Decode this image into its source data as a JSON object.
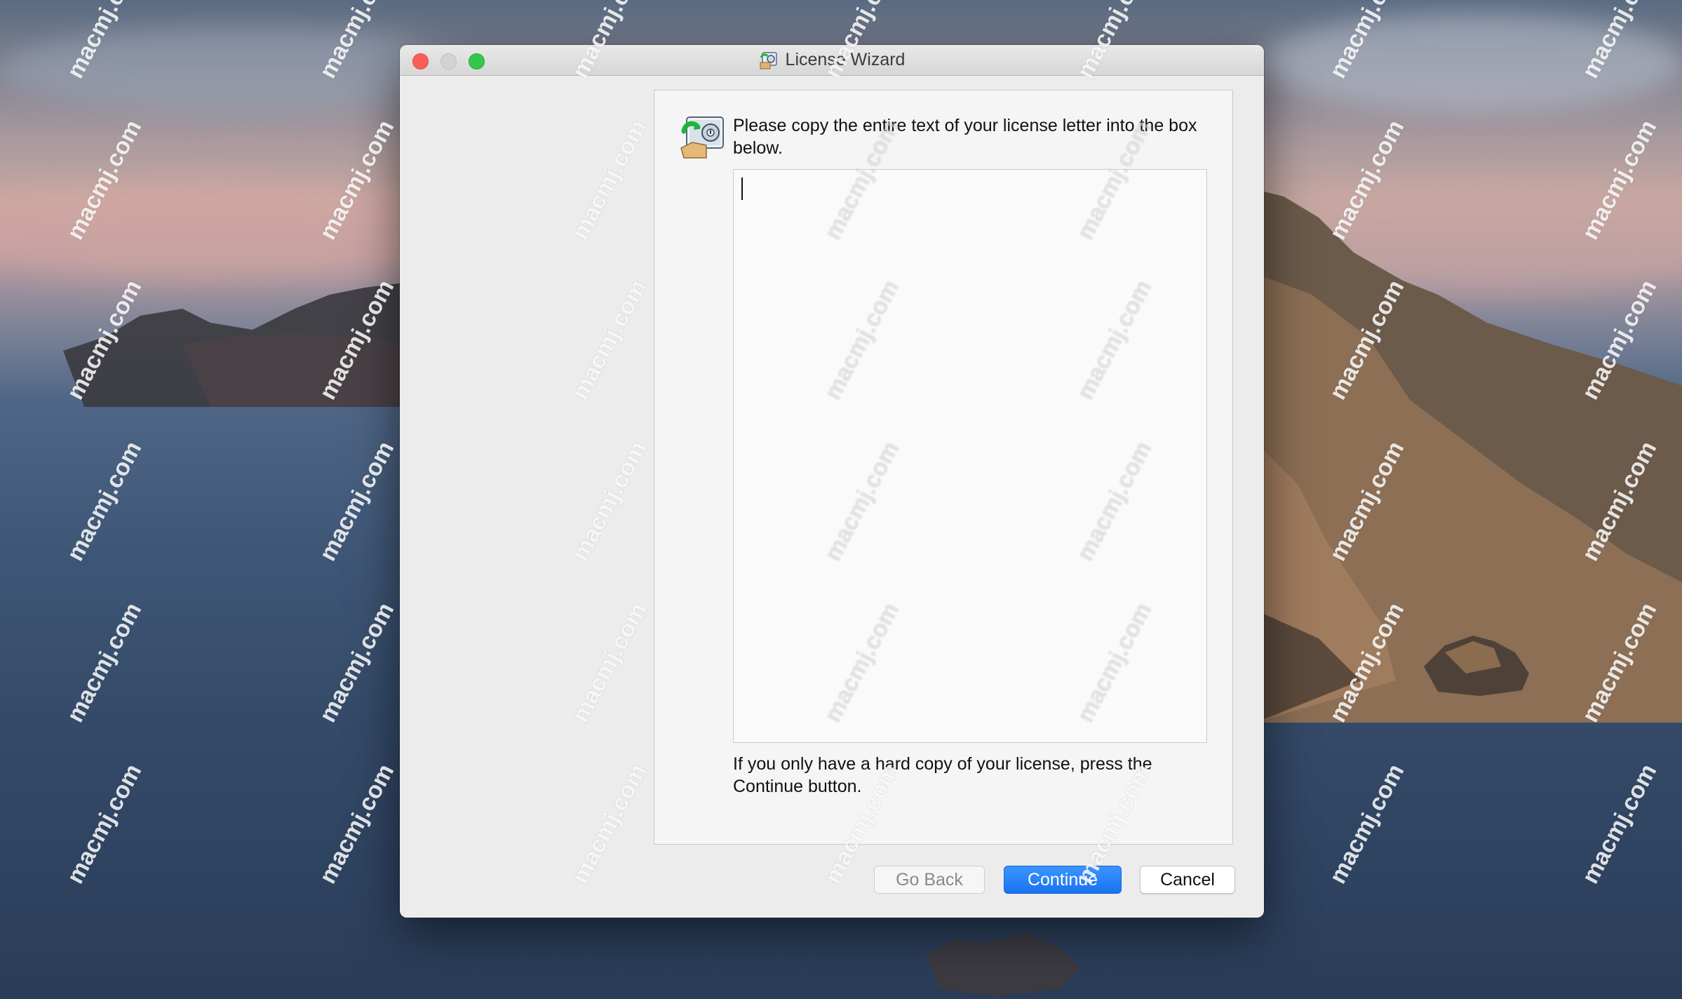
{
  "window": {
    "title": "License Wizard"
  },
  "wizard": {
    "instruction": "Please copy the entire text of your license letter into the box below.",
    "license_text": "",
    "footnote": "If you only have a hard copy of your license, press the Continue button."
  },
  "buttons": {
    "back_label": "Go Back",
    "continue_label": "Continue",
    "cancel_label": "Cancel"
  },
  "watermark": {
    "text": "macmj.com"
  },
  "colors": {
    "accent": "#1a72f0",
    "close": "#fc5f57",
    "zoom": "#34c84a"
  }
}
